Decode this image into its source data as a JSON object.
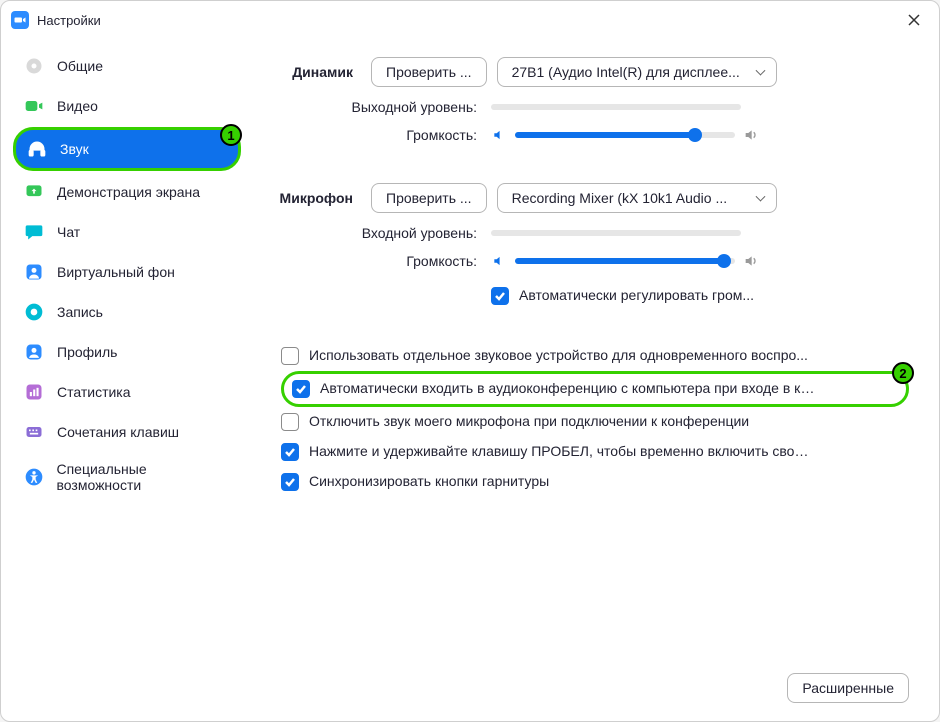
{
  "titlebar": {
    "title": "Настройки"
  },
  "sidebar": {
    "items": [
      {
        "key": "general",
        "label": "Общие"
      },
      {
        "key": "video",
        "label": "Видео"
      },
      {
        "key": "audio",
        "label": "Звук"
      },
      {
        "key": "share",
        "label": "Демонстрация экрана"
      },
      {
        "key": "chat",
        "label": "Чат"
      },
      {
        "key": "vb",
        "label": "Виртуальный фон"
      },
      {
        "key": "recording",
        "label": "Запись"
      },
      {
        "key": "profile",
        "label": "Профиль"
      },
      {
        "key": "stats",
        "label": "Статистика"
      },
      {
        "key": "shortcuts",
        "label": "Сочетания клавиш"
      },
      {
        "key": "accessibility",
        "label": "Специальные возможности"
      }
    ]
  },
  "annotations": {
    "badge1": "1",
    "badge2": "2"
  },
  "audio": {
    "speaker": {
      "section_label": "Динамик",
      "test_btn": "Проверить ...",
      "device": "27B1 (Аудио Intel(R) для дисплее...",
      "output_level_label": "Выходной уровень:",
      "volume_label": "Громкость:",
      "volume_percent": 82
    },
    "mic": {
      "section_label": "Микрофон",
      "test_btn": "Проверить ...",
      "device": "Recording Mixer (kX 10k1 Audio ...",
      "input_level_label": "Входной уровень:",
      "volume_label": "Громкость:",
      "volume_percent": 95,
      "auto_adjust_label": "Автоматически регулировать гром..."
    },
    "checks": {
      "separate_device": "Использовать отдельное звуковое устройство для одновременного воспро...",
      "auto_join_audio": "Автоматически входить в аудиоконференцию с компьютера при входе в кон...",
      "mute_on_join": "Отключить звук моего микрофона при подключении к конференции",
      "push_to_talk": "Нажмите и удерживайте клавишу ПРОБЕЛ, чтобы временно включить свой з...",
      "sync_headset": "Синхронизировать кнопки гарнитуры"
    },
    "advanced_btn": "Расширенные"
  },
  "colors": {
    "accent": "#0E71EB",
    "highlight": "#36d000"
  }
}
